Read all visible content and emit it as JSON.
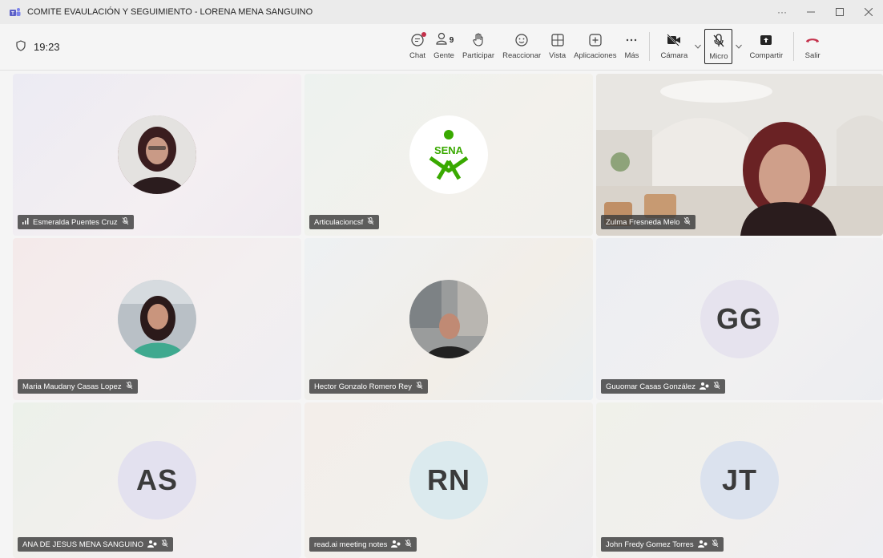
{
  "window": {
    "title": "COMITE EVAULACIÓN Y SEGUIMIENTO - LORENA MENA SANGUINO"
  },
  "meeting": {
    "timer": "19:23"
  },
  "toolbar": {
    "chat": "Chat",
    "people": "Gente",
    "people_count": "9",
    "raise": "Participar",
    "react": "Reaccionar",
    "view": "Vista",
    "apps": "Aplicaciones",
    "more": "Más",
    "camera": "Cámara",
    "mic": "Micro",
    "share": "Compartir",
    "leave": "Salir"
  },
  "colors": {
    "leave": "#c4314b",
    "tag_bg": "#3c3c3c",
    "sena_green": "#39a900"
  },
  "participants": [
    {
      "name": "Esmeralda Puentes Cruz",
      "type": "photo",
      "speaking": true
    },
    {
      "name": "Articulacioncsf",
      "type": "logo",
      "logo_text": "SENA"
    },
    {
      "name": "Zulma Fresneda Melo",
      "type": "video"
    },
    {
      "name": "Maria Maudany Casas Lopez",
      "type": "photo"
    },
    {
      "name": "Hector Gonzalo Romero Rey",
      "type": "photo"
    },
    {
      "name": "Guuomar Casas González",
      "type": "initials",
      "initials": "GG",
      "external": true
    },
    {
      "name": "ANA DE JESUS MENA SANGUINO",
      "type": "initials",
      "initials": "AS",
      "external": true
    },
    {
      "name": "read.ai meeting notes",
      "type": "initials",
      "initials": "RN",
      "external": true
    },
    {
      "name": "John Fredy Gomez Torres",
      "type": "initials",
      "initials": "JT",
      "external": true
    }
  ]
}
